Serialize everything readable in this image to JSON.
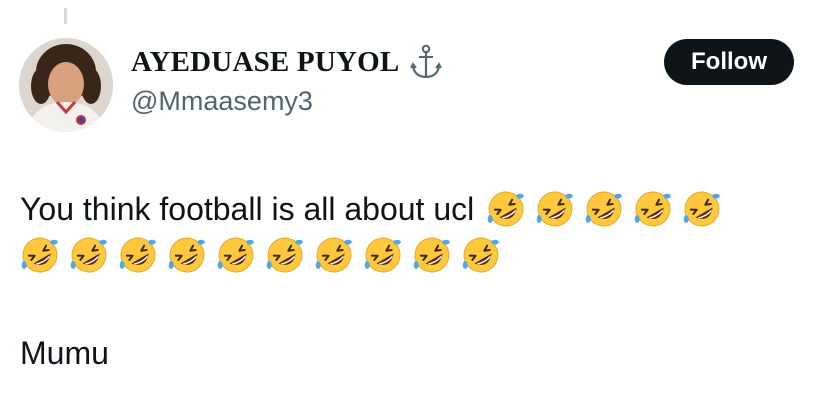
{
  "tweet": {
    "author": {
      "display_name": "AYEDUASE PUYOL",
      "name_icon": "anchor-icon",
      "handle": "@Mmaasemy3",
      "avatar_icon": "avatar-photo"
    },
    "follow_label": "Follow",
    "text": {
      "line1": "You think football is all about ucl",
      "emoji_name": "rolling-on-the-floor-laughing-emoji",
      "line1_emoji_count": 5,
      "line2_emoji_count": 10,
      "closing": "Mumu"
    }
  },
  "colors": {
    "text": "#0f1419",
    "secondary_text": "#536471",
    "button_bg": "#0f1419",
    "button_text": "#ffffff",
    "emoji_face": "#ffc83d"
  }
}
